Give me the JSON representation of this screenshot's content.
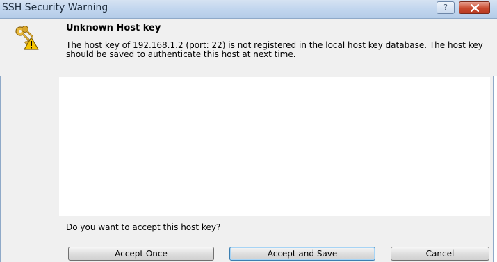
{
  "window": {
    "title": "SSH Security Warning",
    "help_label": "?"
  },
  "warning": {
    "heading": "Unknown Host key",
    "message": "The host key of 192.168.1.2 (port: 22) is not registered in the local host key database. The host key should be saved to authenticate this host at next time.",
    "icon": "keys-warning-icon"
  },
  "prompt": {
    "question": "Do you want to accept this host key?"
  },
  "buttons": {
    "accept_once": "Accept Once",
    "accept_save": "Accept and Save",
    "cancel": "Cancel"
  },
  "colors": {
    "titlebar": "#c2d6ee",
    "close_button": "#c94a2f",
    "dialog_bg": "#f0f0f0"
  }
}
